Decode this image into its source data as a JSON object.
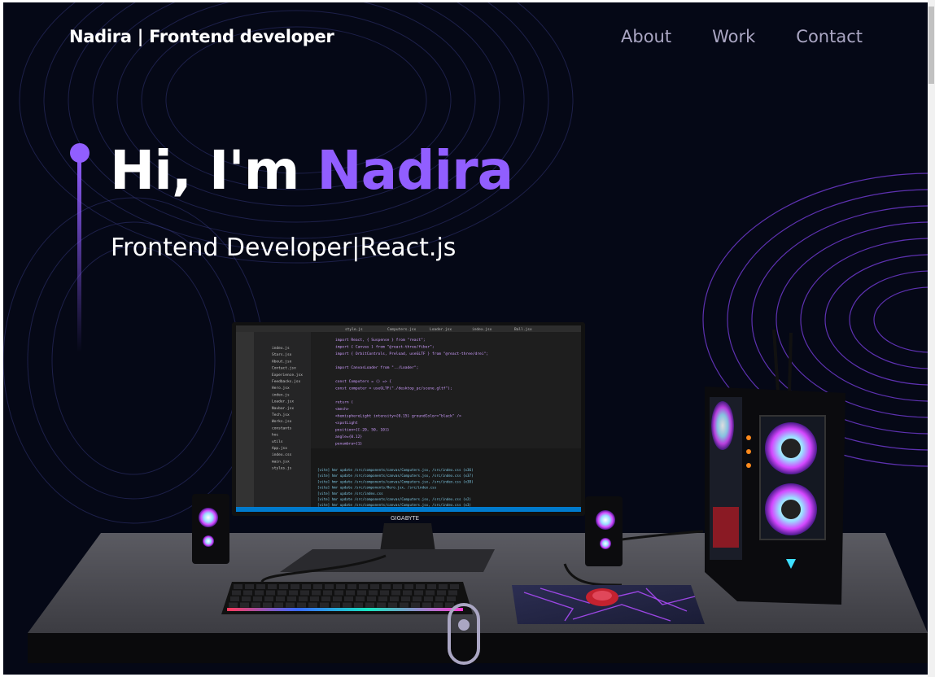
{
  "nav": {
    "brand": "Nadira  | Frontend developer",
    "links": [
      "About",
      "Work",
      "Contact"
    ]
  },
  "hero": {
    "greeting": "Hi, I'm ",
    "name": "Nadira",
    "subtitle": "Frontend Developer|React.js"
  },
  "monitor": {
    "brand_label": "GIGABYTE",
    "tabs": [
      "style.js",
      "Computers.jsx",
      "Loader.jsx",
      "index.jsx",
      "Ball.jsx"
    ],
    "files": [
      "index.js",
      "Stars.jsx",
      "About.jsx",
      "Contact.jsx",
      "Experience.jsx",
      "Feedbacks.jsx",
      "Hero.jsx",
      "index.js",
      "Loader.jsx",
      "Navbar.jsx",
      "Tech.jsx",
      "Works.jsx",
      "constants",
      "hoc",
      "utils",
      "App.jsx",
      "index.css",
      "main.jsx",
      "styles.js"
    ],
    "code_lines": [
      "import React, { Suspense } from \"react\";",
      "import { Canvas } from \"@react-three/fiber\";",
      "import { OrbitControls, Preload, useGLTF } from \"@react-three/drei\";",
      "",
      "import CanvasLoader from \"../Loader\";",
      "",
      "const Computers = () => {",
      "  const computer = useGLTF(\"./desktop_pc/scene.gltf\");",
      "",
      "  return (",
      "    <mesh>",
      "      <hemisphereLight intensity={0.15} groundColor=\"black\" />",
      "      <spotLight",
      "        position={[-20, 50, 10]}",
      "        angle={0.12}",
      "        penumbra={1}"
    ],
    "terminal_lines": [
      "[vite] hmr update /src/components/canvas/Computers.jsx, /src/index.css (x36)",
      "[vite] hmr update /src/components/canvas/Computers.jsx, /src/index.css (x37)",
      "[vite] hmr update /src/components/canvas/Computers.jsx, /src/index.css (x38)",
      "[vite] hmr update /src/components/Hero.jsx, /src/index.css",
      "[vite] hmr update /src/index.css",
      "[vite] hmr update /src/components/canvas/Computers.jsx, /src/index.css (x2)",
      "[vite] hmr update /src/components/canvas/Computers.jsx, /src/index.css (x3)"
    ]
  },
  "colors": {
    "background": "#050816",
    "accent": "#915eff",
    "secondary_text": "#aaa6c3"
  },
  "icons": {
    "scroll": "mouse-scroll-icon"
  }
}
